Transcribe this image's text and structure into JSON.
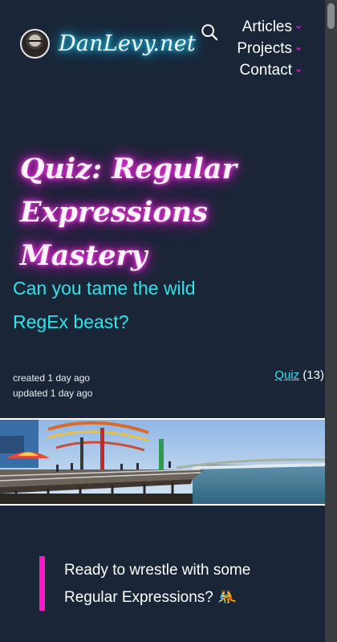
{
  "site": {
    "logo_text": "DanLevy.net",
    "avatar_alt": "avatar"
  },
  "nav": {
    "items": [
      {
        "label": "Articles"
      },
      {
        "label": "Projects"
      },
      {
        "label": "Contact"
      }
    ]
  },
  "icons": {
    "search": "search-icon",
    "chevron": "chevron-down-icon"
  },
  "colors": {
    "background": "#1a2637",
    "title_glow": "#e81ed8",
    "logo_glow": "#1fb7e8",
    "subtitle": "#2fe3ec",
    "callout_bar": "#ff16c8"
  },
  "article": {
    "title": "Quiz: Regular Expressions Mastery",
    "subtitle": "Can you tame the wild RegEx beast?",
    "created": "created 1 day ago",
    "updated": "updated 1 day ago",
    "tag_label": "Quiz",
    "tag_count": "(13)",
    "callout": "Ready to wrestle with some Regular Expressions? 🤼"
  }
}
